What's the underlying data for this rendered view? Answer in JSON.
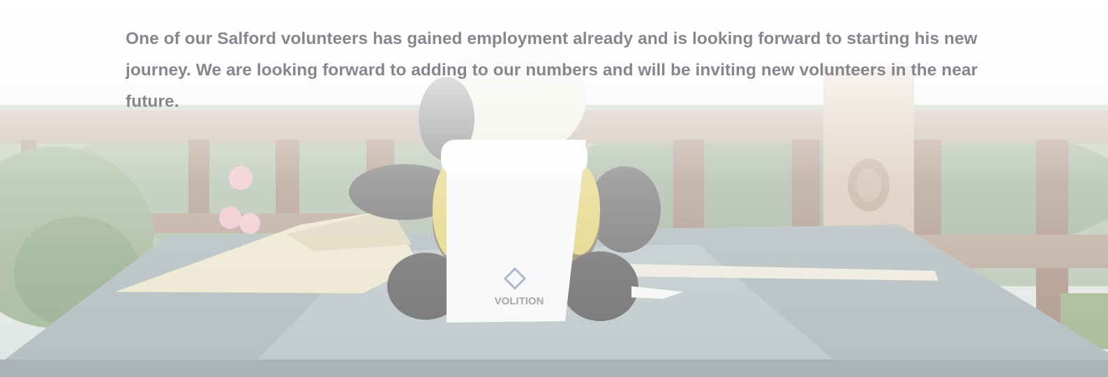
{
  "article": {
    "paragraph": "One of our Salford volunteers has gained employment already and is looking forward to starting his new journey.  We are looking forward to adding to our numbers and will be inviting new volunteers in the near future."
  },
  "photo": {
    "subject": "plush toy wearing a scarf on a garden table",
    "scarf_logo_text": "VOLITION"
  },
  "colors": {
    "text": "#85878c",
    "fence": "#8a6a55",
    "table": "#8f9ea1",
    "foliage": "#6f8a62"
  }
}
